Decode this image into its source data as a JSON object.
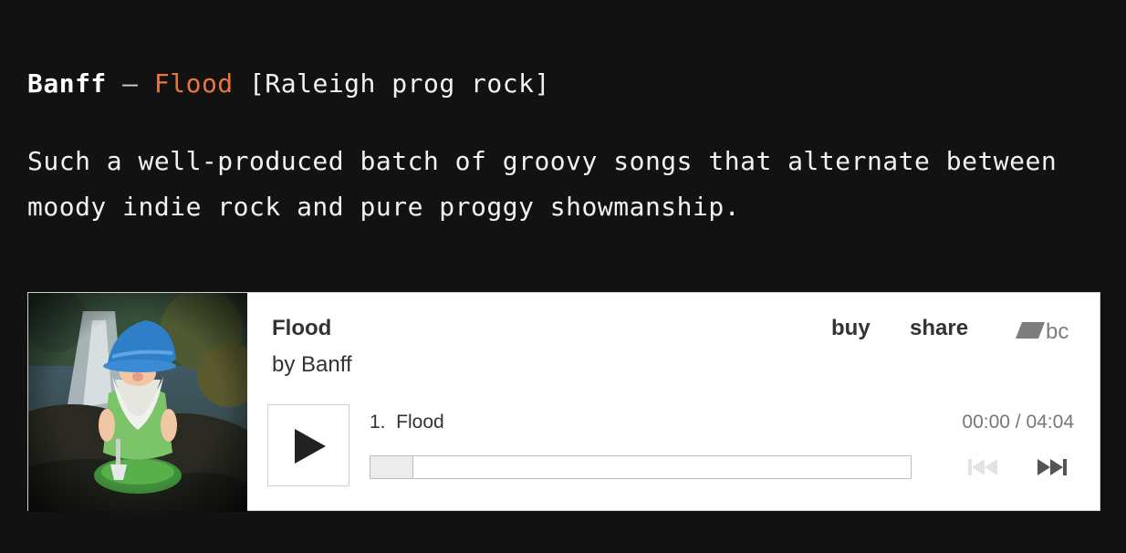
{
  "post": {
    "artist": "Banff",
    "separator": "–",
    "album": "Flood",
    "genre": "[Raleigh prog rock]",
    "description": "Such a well-produced batch of groovy songs that alternate between moody indie rock and pure proggy showmanship.",
    "link_color": "#e8763d"
  },
  "player": {
    "album_title": "Flood",
    "by_artist": "by Banff",
    "buy_label": "buy",
    "share_label": "share",
    "logo_text": "bc",
    "track": {
      "number": "1.",
      "title": "Flood",
      "display": "1.  Flood"
    },
    "time": "00:00 / 04:04",
    "progress_fraction": 0.0,
    "icons": {
      "play": "play-icon",
      "prev": "skip-previous-icon",
      "next": "skip-next-icon",
      "logo": "bandcamp-logo-icon"
    }
  }
}
